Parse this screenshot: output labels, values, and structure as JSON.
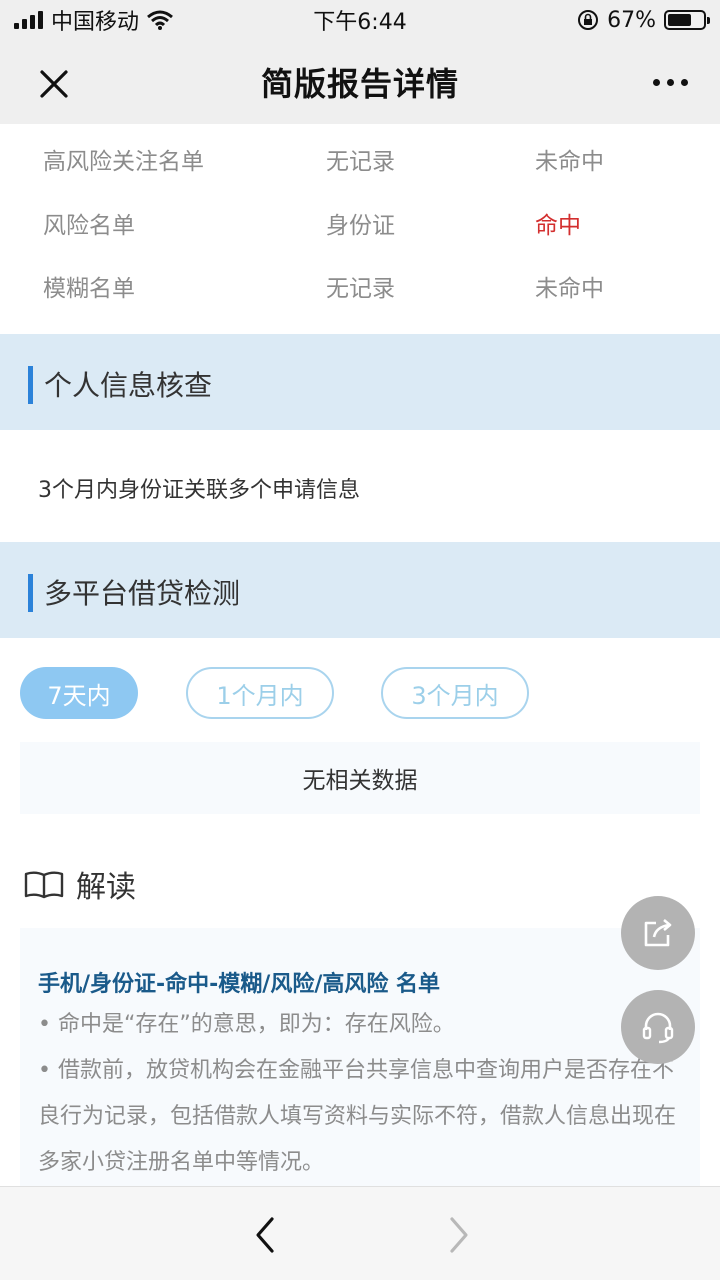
{
  "status_bar": {
    "carrier": "中国移动",
    "time": "下午6:44",
    "battery_percent": "67%",
    "battery_level": 0.67
  },
  "nav": {
    "title": "简版报告详情",
    "close_icon": "close-icon",
    "more_icon": "more-icon"
  },
  "risk_rows": [
    {
      "name": "高风险关注名单",
      "type": "无记录",
      "result": "未命中"
    },
    {
      "name": "风险名单",
      "type": "身份证",
      "result": "命中"
    },
    {
      "name": "模糊名单",
      "type": "无记录",
      "result": "未命中"
    }
  ],
  "personal_check": {
    "title": "个人信息核查",
    "text": "3个月内身份证关联多个申请信息"
  },
  "multi_platform": {
    "title": "多平台借贷检测",
    "tabs": [
      {
        "label": "7天内",
        "active": true
      },
      {
        "label": "1个月内",
        "active": false
      },
      {
        "label": "3个月内",
        "active": false
      }
    ],
    "empty_text": "无相关数据"
  },
  "explain": {
    "heading": "解读",
    "title": "手机/身份证-命中-模糊/风险/高风险 名单",
    "item1": "• 命中是“存在”的意思，即为：存在风险。",
    "item2": "• 借款前，放贷机构会在金融平台共享信息中查询用户是否存在不良行为记录，包括借款人填写资料与实际不符，借款人信息出现在多家小贷注册名单中等情况。"
  },
  "colors": {
    "accent": "#2b82d9",
    "hit": "#d32f2f",
    "section_bg": "#dbeaf5"
  }
}
